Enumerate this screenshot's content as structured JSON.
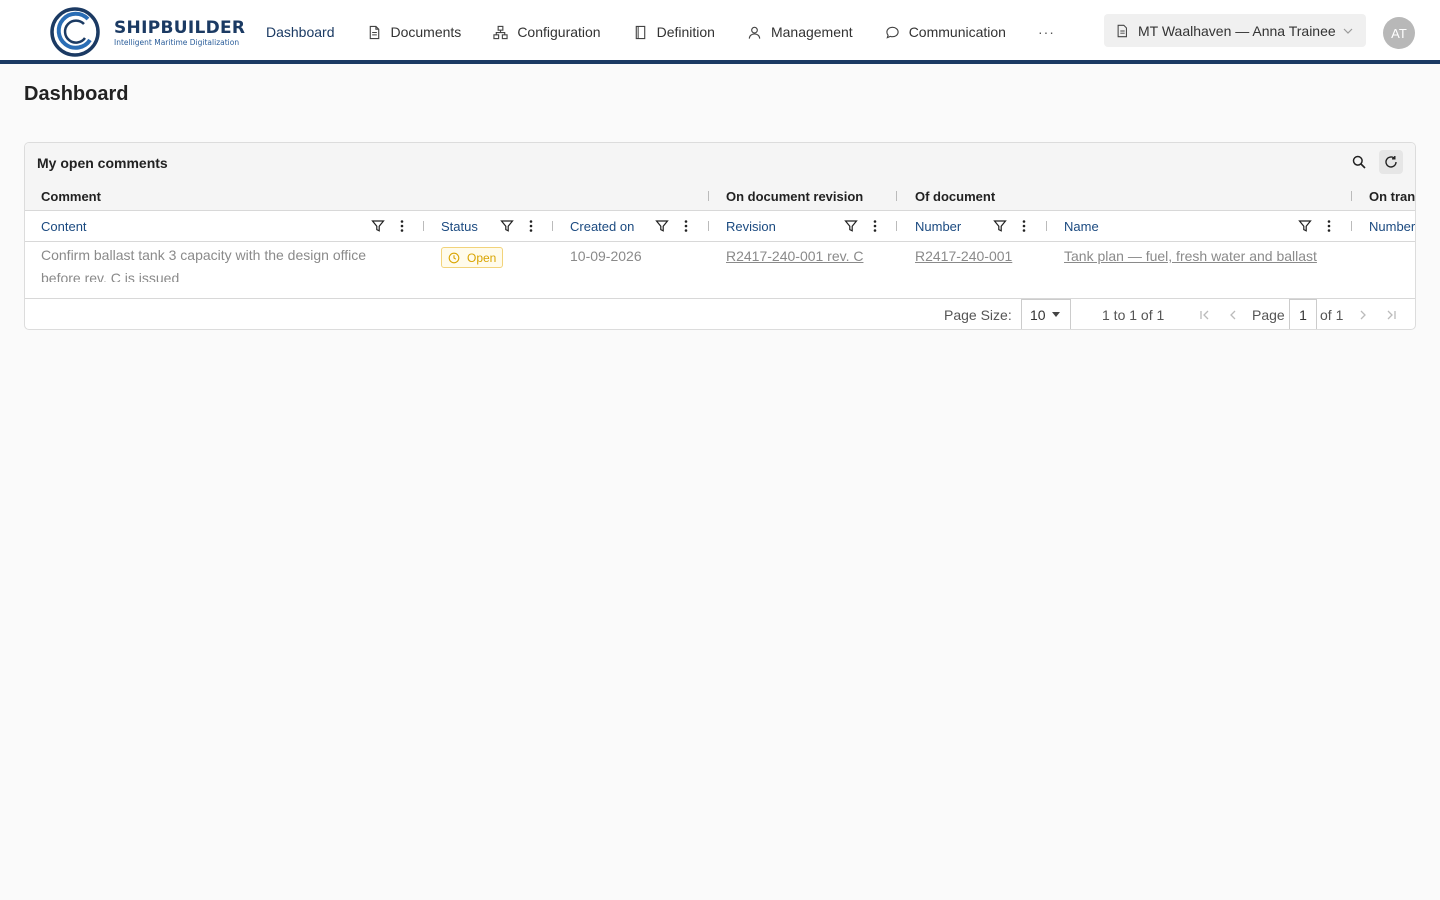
{
  "brand": {
    "name": "SHIPBUILDER",
    "tagline": "Intelligent Maritime Digitalization"
  },
  "nav": {
    "items": [
      {
        "label": "Dashboard",
        "icon": "none",
        "active": true
      },
      {
        "label": "Documents",
        "icon": "document-icon"
      },
      {
        "label": "Configuration",
        "icon": "hierarchy-icon"
      },
      {
        "label": "Definition",
        "icon": "book-icon"
      },
      {
        "label": "Management",
        "icon": "user-icon"
      },
      {
        "label": "Communication",
        "icon": "chat-icon"
      }
    ],
    "more": "···"
  },
  "context": {
    "ship_user": "MT Waalhaven — Anna Trainee"
  },
  "user": {
    "initials": "AT"
  },
  "page": {
    "title": "Dashboard"
  },
  "panel": {
    "title": "My open comments",
    "groups": [
      "Comment",
      "On document revision",
      "Of document",
      "On tran"
    ],
    "columns": [
      "Content",
      "Status",
      "Created on",
      "Revision",
      "Number",
      "Name",
      "Number"
    ],
    "rows": [
      {
        "content": "Confirm ballast tank 3 capacity with the design office before rev. C is issued",
        "status": "Open",
        "created_on": "10-09-2026",
        "revision": "R2417-240-001 rev. C",
        "number": "R2417-240-001",
        "name": "Tank plan — fuel, fresh water and ballast"
      }
    ],
    "footer": {
      "page_size_label": "Page Size:",
      "page_size": "10",
      "range": "1 to 1 of 1",
      "page_label": "Page",
      "page": "1",
      "of_label": "of 1"
    }
  },
  "colors": {
    "brand": "#1b3a63",
    "link": "#1b4a80",
    "status_open": "#d9a400"
  }
}
